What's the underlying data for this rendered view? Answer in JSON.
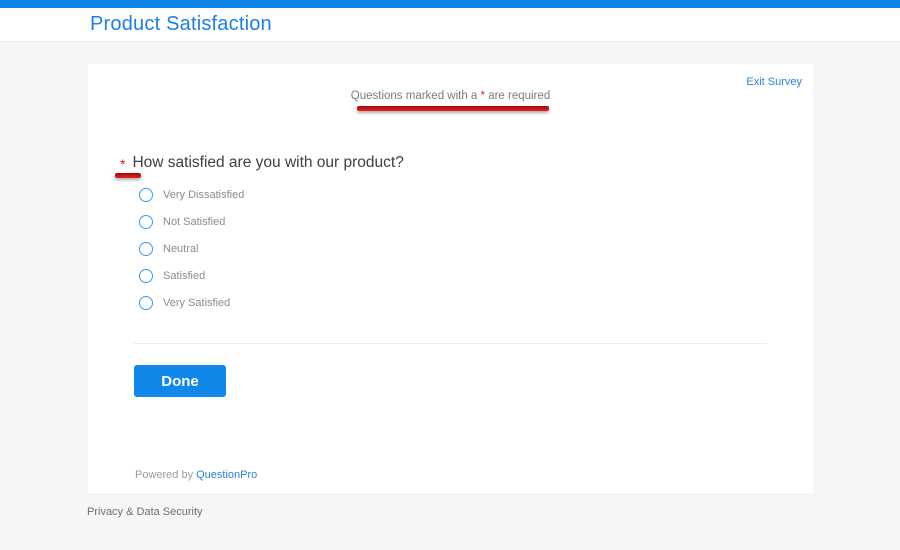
{
  "page": {
    "header": {
      "title": "Product Satisfaction"
    },
    "card": {
      "exit_link": "Exit Survey",
      "required_note": {
        "prefix": "Questions marked with a ",
        "asterisk": "*",
        "suffix": " are required"
      },
      "question": {
        "required_marker": "*",
        "text": "How satisfied are you with our product?",
        "options": [
          {
            "label": "Very Dissatisfied"
          },
          {
            "label": "Not Satisfied"
          },
          {
            "label": "Neutral"
          },
          {
            "label": "Satisfied"
          },
          {
            "label": "Very Satisfied"
          }
        ]
      },
      "done_button": "Done",
      "powered_by": {
        "prefix": "Powered by",
        "brand": "QuestionPro"
      }
    },
    "footer": {
      "privacy_link": "Privacy & Data Security"
    },
    "colors": {
      "top_bar_blue": "#0d86e8",
      "title_blue": "#1b7fe4",
      "link_blue": "#2e7fe0",
      "button_blue": "#1187e9",
      "radio_blue": "#3b9be8",
      "annotation_red": "#c41414",
      "background_gray": "#f6f6f7"
    }
  }
}
